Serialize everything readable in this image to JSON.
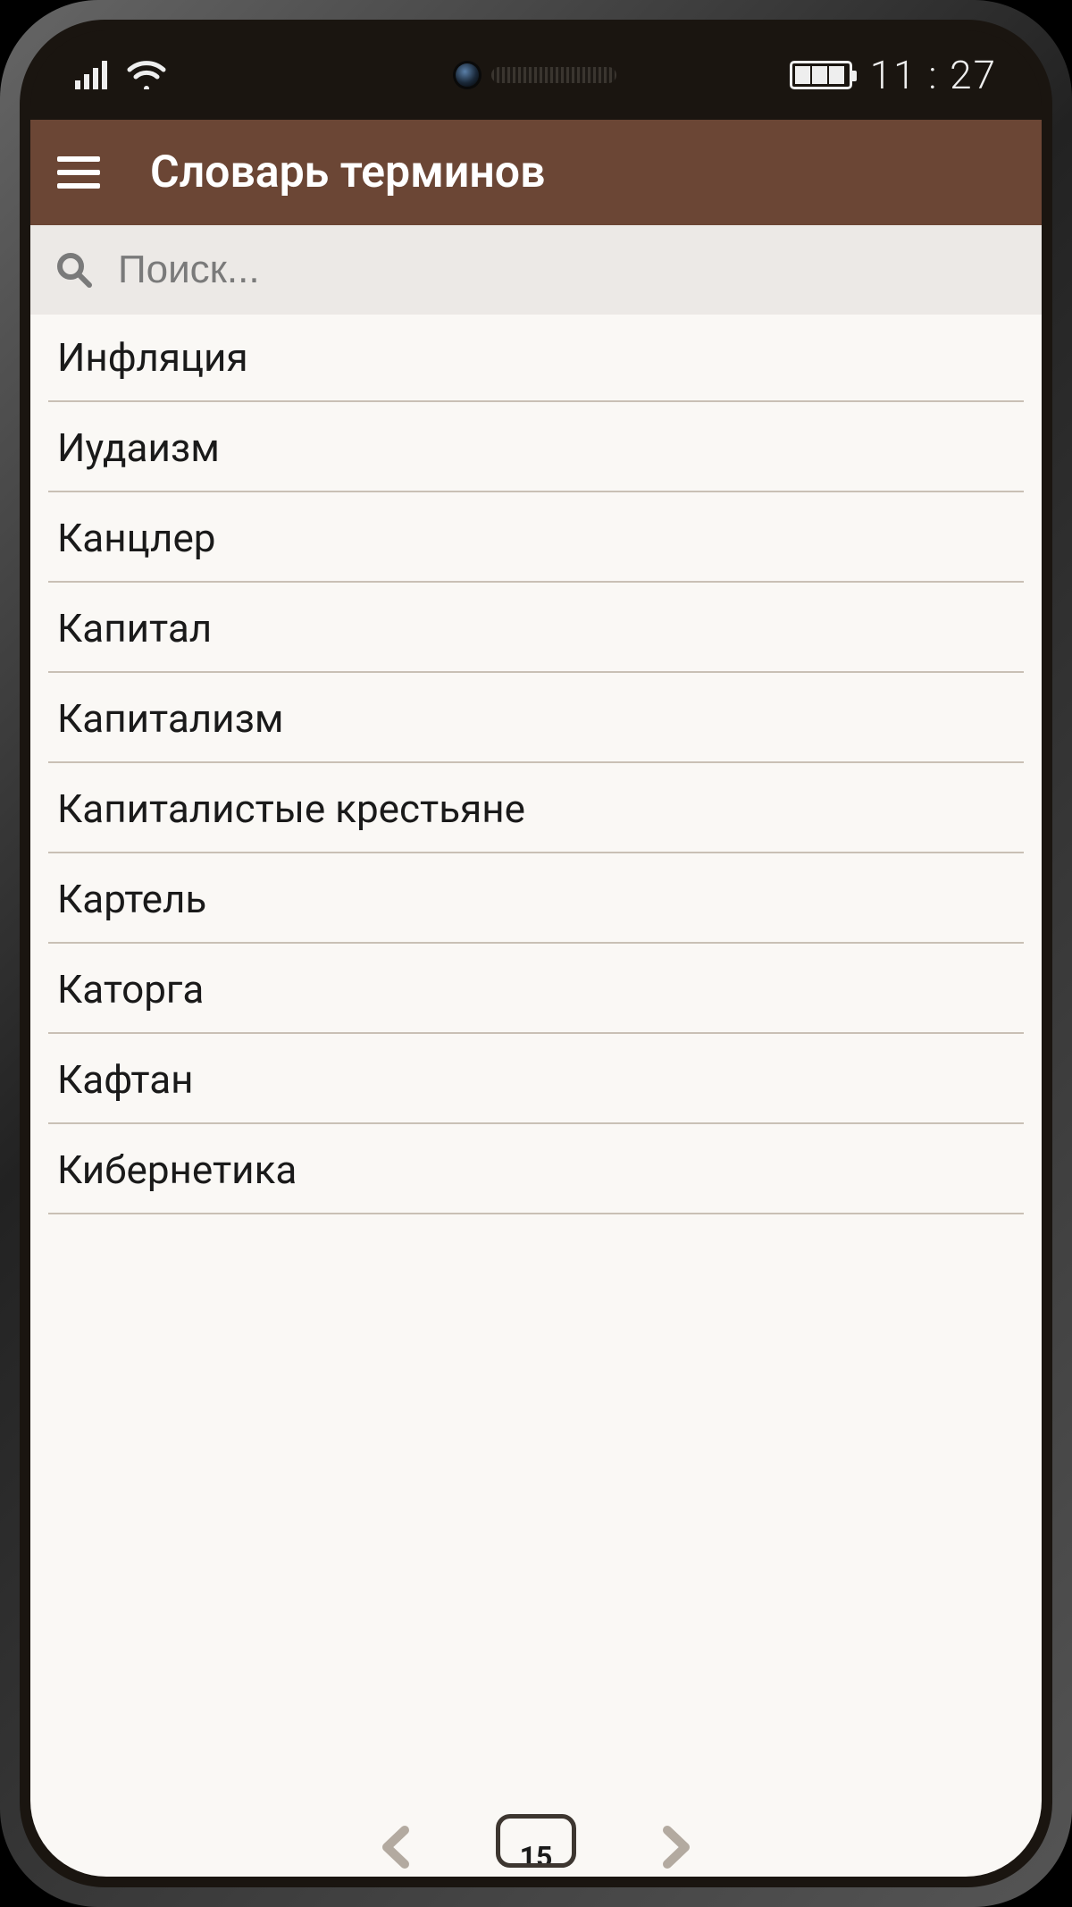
{
  "statusbar": {
    "time": "11 : 27"
  },
  "header": {
    "title": "Словарь терминов"
  },
  "search": {
    "placeholder": "Поиск..."
  },
  "terms": [
    {
      "label": "Инфляция"
    },
    {
      "label": "Иудаизм"
    },
    {
      "label": "Канцлер"
    },
    {
      "label": "Капитал"
    },
    {
      "label": "Капитализм"
    },
    {
      "label": "Капиталистые крестьяне"
    },
    {
      "label": "Картель"
    },
    {
      "label": "Каторга"
    },
    {
      "label": "Кафтан"
    },
    {
      "label": "Кибернетика"
    }
  ],
  "pagination": {
    "current": "15"
  }
}
